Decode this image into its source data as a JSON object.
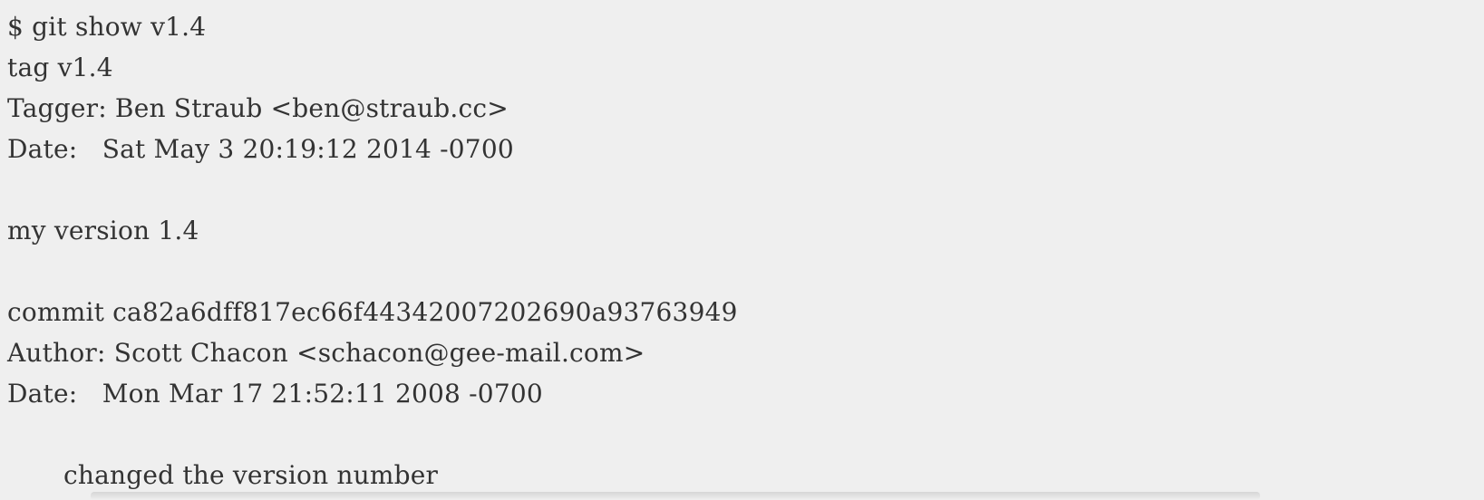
{
  "code": {
    "lines": [
      "$ git show v1.4",
      "tag v1.4",
      "Tagger: Ben Straub <ben@straub.cc>",
      "Date:   Sat May 3 20:19:12 2014 -0700",
      "",
      "my version 1.4",
      "",
      "commit ca82a6dff817ec66f44342007202690a93763949",
      "Author: Scott Chacon <schacon@gee-mail.com>",
      "Date:   Mon Mar 17 21:52:11 2008 -0700",
      "",
      "changed the version number"
    ]
  }
}
